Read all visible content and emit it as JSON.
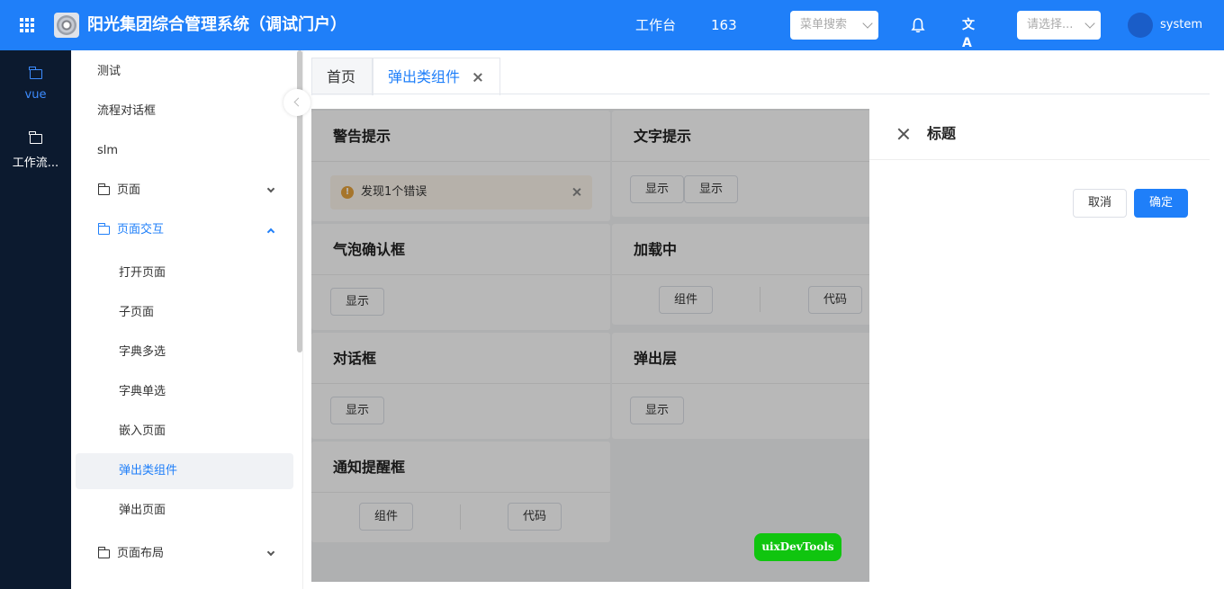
{
  "header": {
    "title": "阳光集团综合管理系统（调试门户）",
    "workbench": "工作台",
    "count": "163",
    "menu_search_placeholder": "菜单搜索",
    "select_placeholder": "请选择...",
    "username": "system",
    "translate_glyph": "文A"
  },
  "rail": {
    "items": [
      {
        "label": "vue"
      },
      {
        "label": "工作流..."
      }
    ]
  },
  "sidebar": {
    "items": [
      {
        "label": "测试"
      },
      {
        "label": "流程对话框"
      },
      {
        "label": "slm"
      },
      {
        "label": "页面"
      },
      {
        "label": "页面交互"
      },
      {
        "label": "打开页面"
      },
      {
        "label": "子页面"
      },
      {
        "label": "字典多选"
      },
      {
        "label": "字典单选"
      },
      {
        "label": "嵌入页面"
      },
      {
        "label": "弹出类组件"
      },
      {
        "label": "弹出页面"
      },
      {
        "label": "页面布局"
      }
    ]
  },
  "tabs": [
    {
      "label": "首页"
    },
    {
      "label": "弹出类组件"
    }
  ],
  "cards": {
    "alert": {
      "title": "警告提示",
      "message": "发现1个错误",
      "icon": "!"
    },
    "text_tip": {
      "title": "文字提示",
      "btn1": "显示",
      "btn2": "显示"
    },
    "popconfirm": {
      "title": "气泡确认框",
      "btn": "显示"
    },
    "loading": {
      "title": "加载中",
      "btn1": "组件",
      "btn2": "代码"
    },
    "dialog": {
      "title": "对话框",
      "btn": "显示"
    },
    "popup": {
      "title": "弹出层",
      "btn": "显示"
    },
    "notification": {
      "title": "通知提醒框",
      "btn1": "组件",
      "btn2": "代码"
    }
  },
  "devtools": {
    "label": "uixDevTools"
  },
  "drawer": {
    "title": "标题",
    "cancel": "取消",
    "confirm": "确定"
  },
  "colors": {
    "primary": "#1f7ff9",
    "rail": "#0c1a2f",
    "devtools": "#10c50f",
    "warning": "#e6a23c"
  }
}
